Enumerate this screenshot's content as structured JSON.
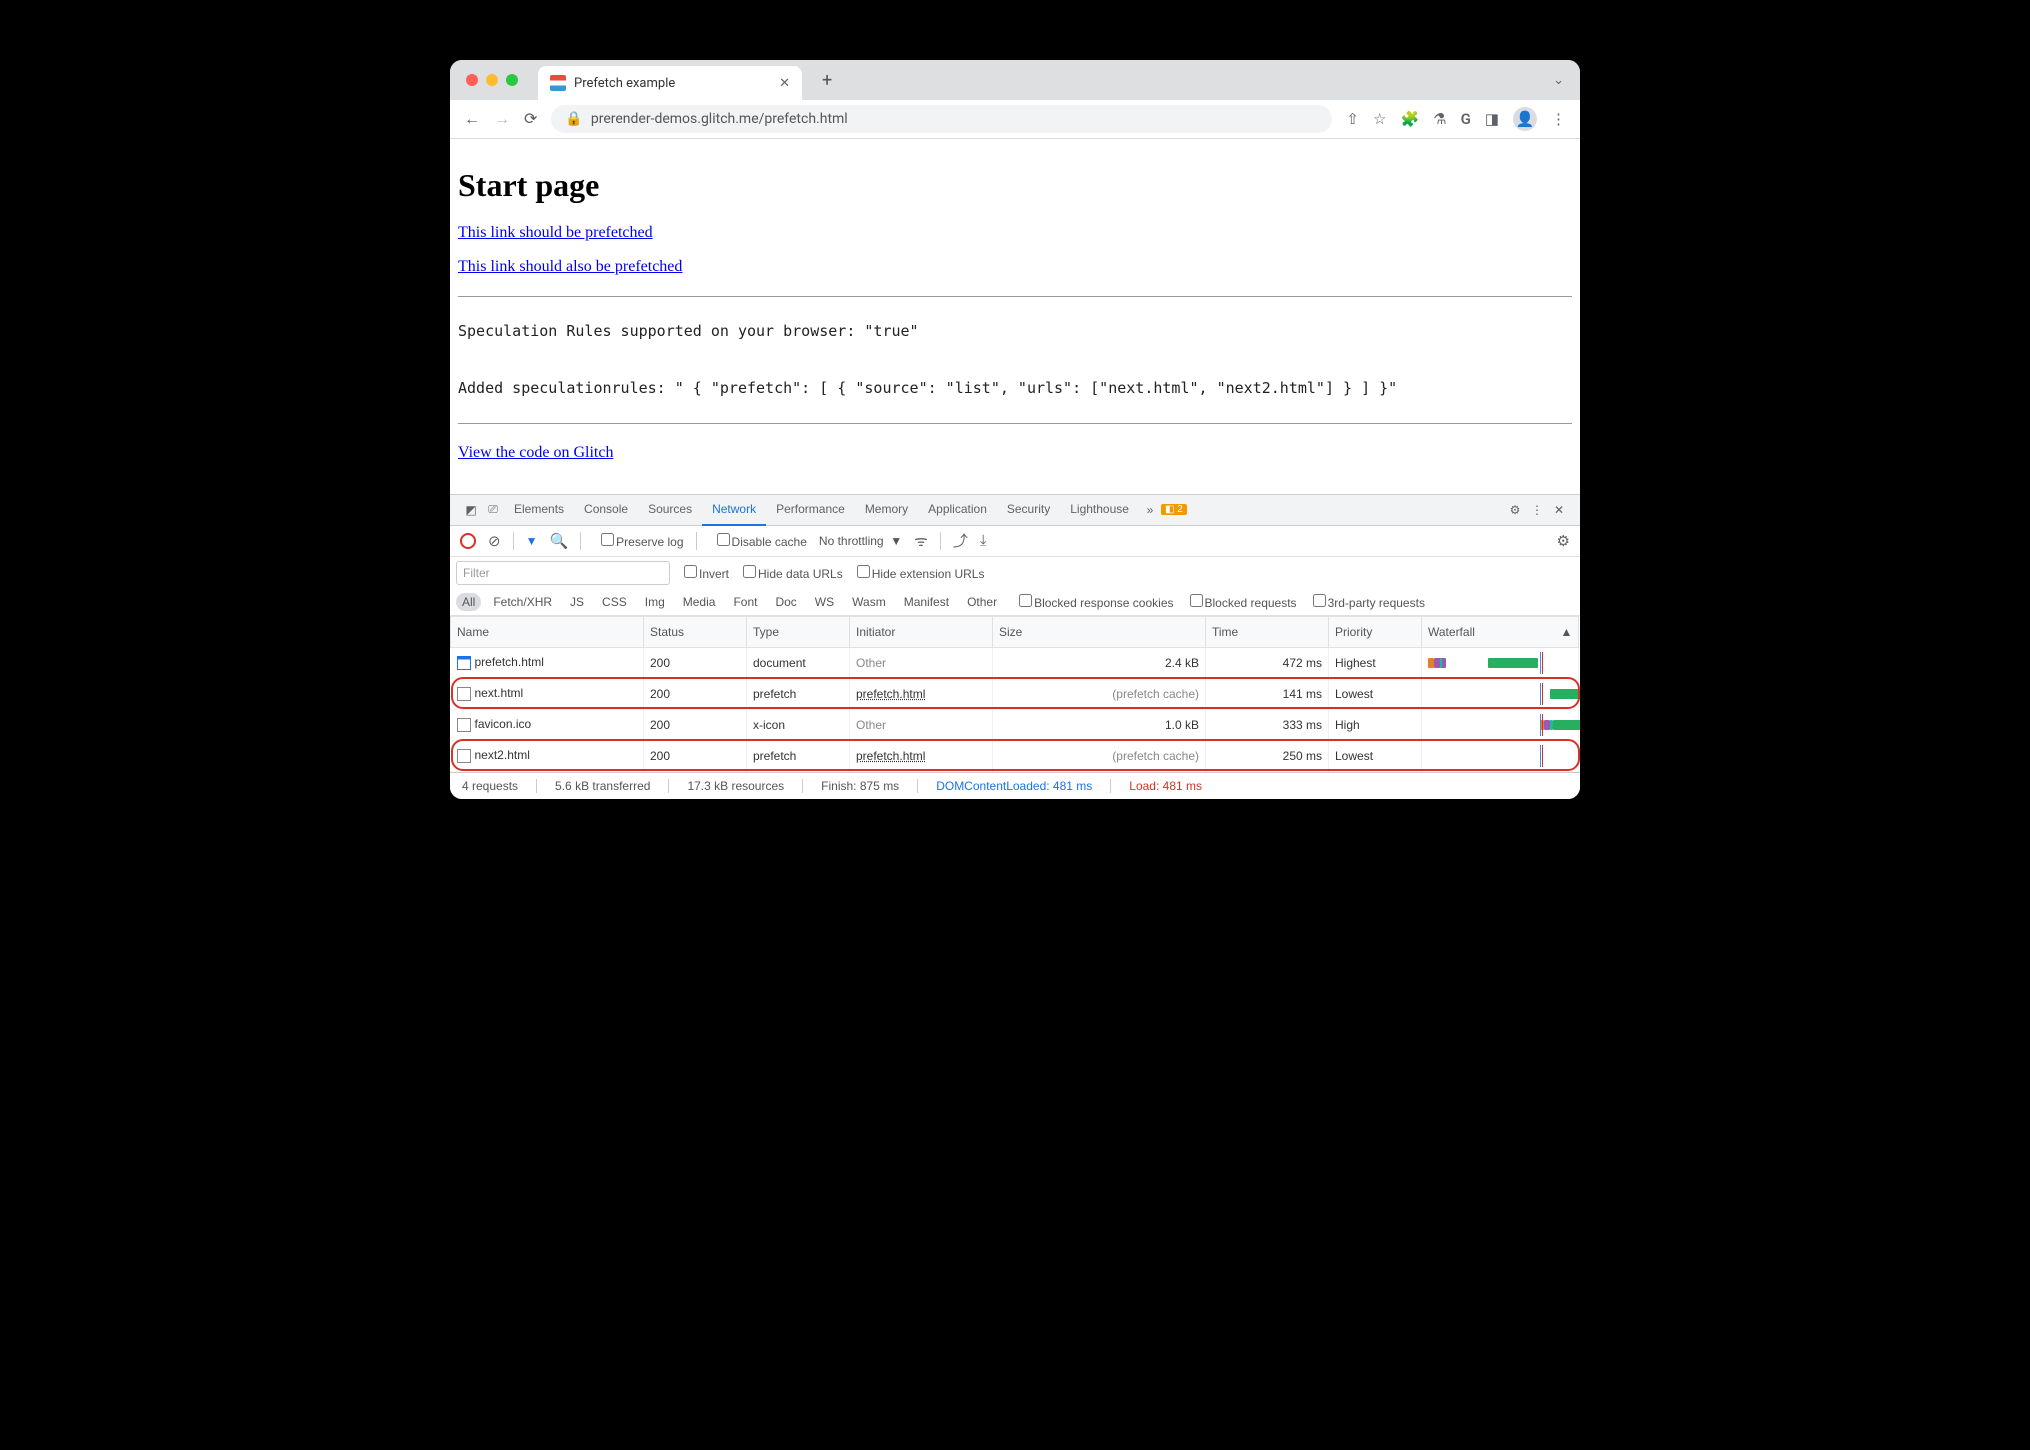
{
  "tab": {
    "title": "Prefetch example"
  },
  "url": "prerender-demos.glitch.me/prefetch.html",
  "page": {
    "heading": "Start page",
    "link1": "This link should be prefetched",
    "link2": "This link should also be prefetched",
    "mono1": "Speculation Rules supported on your browser: \"true\"",
    "mono2": "Added speculationrules: \" { \"prefetch\": [ { \"source\": \"list\", \"urls\": [\"next.html\", \"next2.html\"] } ] }\"",
    "link3": "View the code on Glitch"
  },
  "devtools": {
    "tabs": [
      "Elements",
      "Console",
      "Sources",
      "Network",
      "Performance",
      "Memory",
      "Application",
      "Security",
      "Lighthouse"
    ],
    "active": "Network",
    "warnCount": "2",
    "toolbar": {
      "preserve": "Preserve log",
      "disable": "Disable cache",
      "throttle": "No throttling"
    },
    "filters": {
      "placeholder": "Filter",
      "invert": "Invert",
      "hideData": "Hide data URLs",
      "hideExt": "Hide extension URLs",
      "types": [
        "All",
        "Fetch/XHR",
        "JS",
        "CSS",
        "Img",
        "Media",
        "Font",
        "Doc",
        "WS",
        "Wasm",
        "Manifest",
        "Other"
      ],
      "blockedCookies": "Blocked response cookies",
      "blockedReq": "Blocked requests",
      "thirdParty": "3rd-party requests"
    },
    "cols": [
      "Name",
      "Status",
      "Type",
      "Initiator",
      "Size",
      "Time",
      "Priority",
      "Waterfall"
    ],
    "rows": [
      {
        "name": "prefetch.html",
        "status": "200",
        "type": "document",
        "initiator": "Other",
        "initMuted": true,
        "size": "2.4 kB",
        "time": "472 ms",
        "priority": "Highest",
        "hl": false,
        "icon": "doc",
        "wf": [
          [
            0,
            6,
            "#e67e22"
          ],
          [
            6,
            12,
            "#9b59b6"
          ],
          [
            12,
            2,
            "#1abc9c"
          ],
          [
            60,
            50,
            "#27ae60"
          ]
        ]
      },
      {
        "name": "next.html",
        "status": "200",
        "type": "prefetch",
        "initiator": "prefetch.html",
        "initMuted": false,
        "size": "(prefetch cache)",
        "sizeMuted": true,
        "time": "141 ms",
        "priority": "Lowest",
        "hl": true,
        "icon": "",
        "wf": [
          [
            122,
            34,
            "#27ae60"
          ],
          [
            156,
            3,
            "#1abc9c"
          ]
        ]
      },
      {
        "name": "favicon.ico",
        "status": "200",
        "type": "x-icon",
        "initiator": "Other",
        "initMuted": true,
        "size": "1.0 kB",
        "time": "333 ms",
        "priority": "High",
        "hl": false,
        "icon": "",
        "wf": [
          [
            112,
            4,
            "#e67e22"
          ],
          [
            116,
            6,
            "#9b59b6"
          ],
          [
            122,
            3,
            "#1abc9c"
          ],
          [
            125,
            80,
            "#27ae60"
          ]
        ]
      },
      {
        "name": "next2.html",
        "status": "200",
        "type": "prefetch",
        "initiator": "prefetch.html",
        "initMuted": false,
        "size": "(prefetch cache)",
        "sizeMuted": true,
        "time": "250 ms",
        "priority": "Lowest",
        "hl": true,
        "icon": "",
        "wf": [
          [
            160,
            42,
            "#27ae60"
          ],
          [
            202,
            3,
            "#1abc9c"
          ]
        ]
      }
    ],
    "status": {
      "req": "4 requests",
      "trans": "5.6 kB transferred",
      "res": "17.3 kB resources",
      "finish": "Finish: 875 ms",
      "dcl": "DOMContentLoaded: 481 ms",
      "load": "Load: 481 ms"
    }
  }
}
